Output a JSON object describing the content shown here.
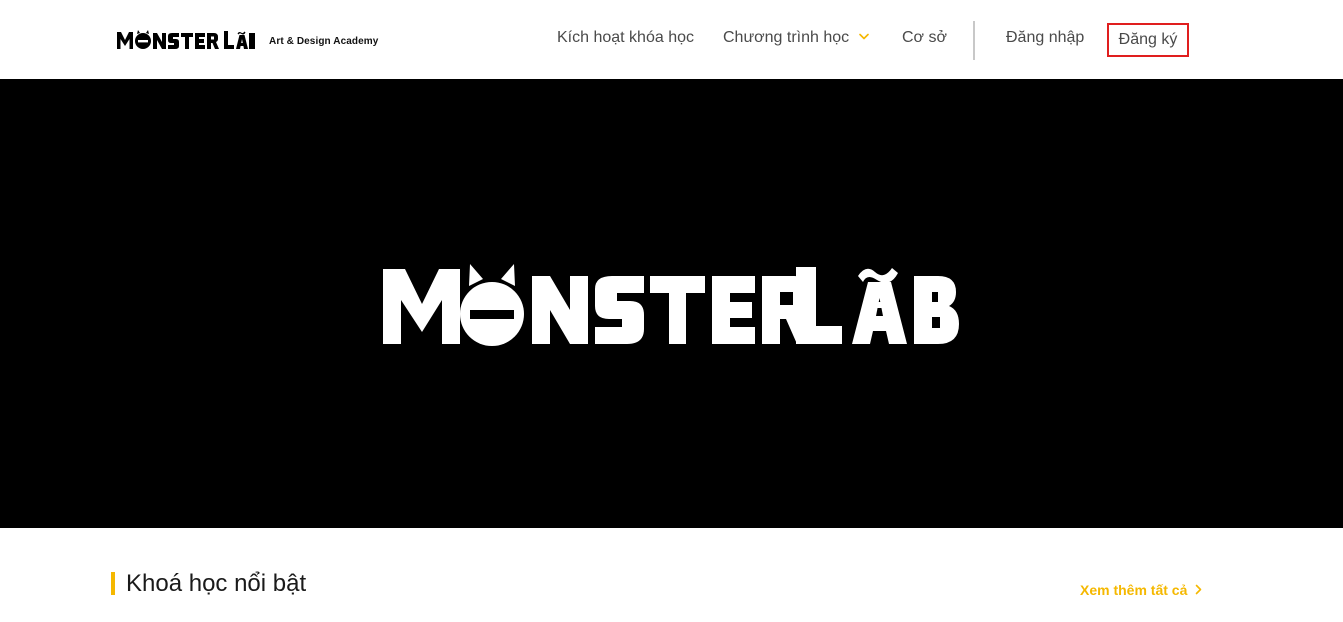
{
  "brand": {
    "logo_text": "MONSTER LAB",
    "tagline": "Art & Design Academy"
  },
  "nav": {
    "activate_label": "Kích hoạt khóa học",
    "programs_label": "Chương trình học",
    "campus_label": "Cơ sở",
    "login_label": "Đăng nhập",
    "register_label": "Đăng ký"
  },
  "hero": {
    "logo_text": "MONSTER LAB"
  },
  "featured": {
    "title": "Khoá học nổi bật",
    "see_all_label": "Xem thêm tất cả"
  },
  "colors": {
    "accent": "#f5b800",
    "hero_bg": "#000000",
    "register_border": "#e01e1e",
    "nav_text": "#4a4a4a"
  },
  "icons": {
    "programs_dropdown": "chevron-down-icon",
    "see_all": "chevron-right-icon"
  }
}
